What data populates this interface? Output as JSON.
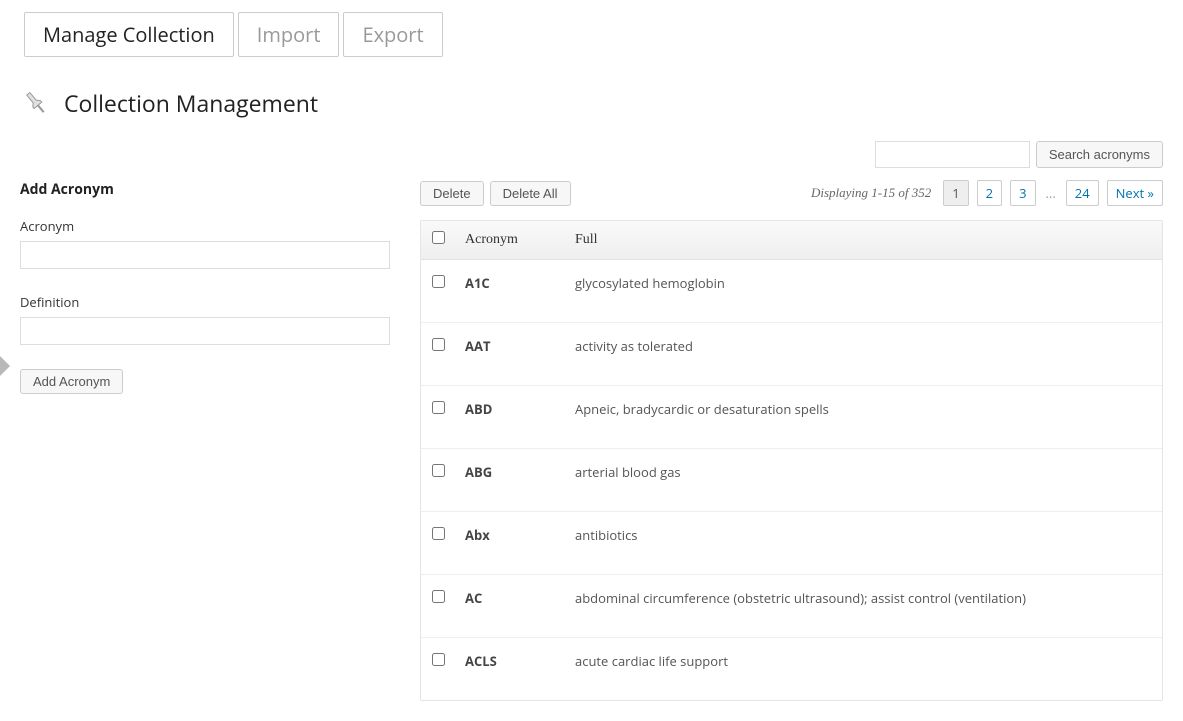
{
  "tabs": [
    {
      "label": "Manage Collection",
      "active": true
    },
    {
      "label": "Import",
      "active": false
    },
    {
      "label": "Export",
      "active": false
    }
  ],
  "page_title": "Collection Management",
  "search": {
    "btn": "Search acronyms",
    "value": ""
  },
  "add_form": {
    "heading": "Add Acronym",
    "acronym_label": "Acronym",
    "definition_label": "Definition",
    "submit": "Add Acronym"
  },
  "toolbar": {
    "delete": "Delete",
    "delete_all": "Delete All",
    "displaying": "Displaying 1-15 of 352"
  },
  "pagination": {
    "pages": [
      "1",
      "2",
      "3"
    ],
    "current": "1",
    "dots": "...",
    "last": "24",
    "next": "Next »"
  },
  "table": {
    "cols": {
      "acronym": "Acronym",
      "full": "Full"
    },
    "rows": [
      {
        "acronym": "A1C",
        "full": "glycosylated hemoglobin"
      },
      {
        "acronym": "AAT",
        "full": "activity as tolerated"
      },
      {
        "acronym": "ABD",
        "full": "Apneic, bradycardic or desaturation spells"
      },
      {
        "acronym": "ABG",
        "full": "arterial blood gas"
      },
      {
        "acronym": "Abx",
        "full": "antibiotics"
      },
      {
        "acronym": "AC",
        "full": "abdominal circumference (obstetric ultrasound); assist control (ventilation)"
      },
      {
        "acronym": "ACLS",
        "full": "acute cardiac life support"
      }
    ]
  }
}
